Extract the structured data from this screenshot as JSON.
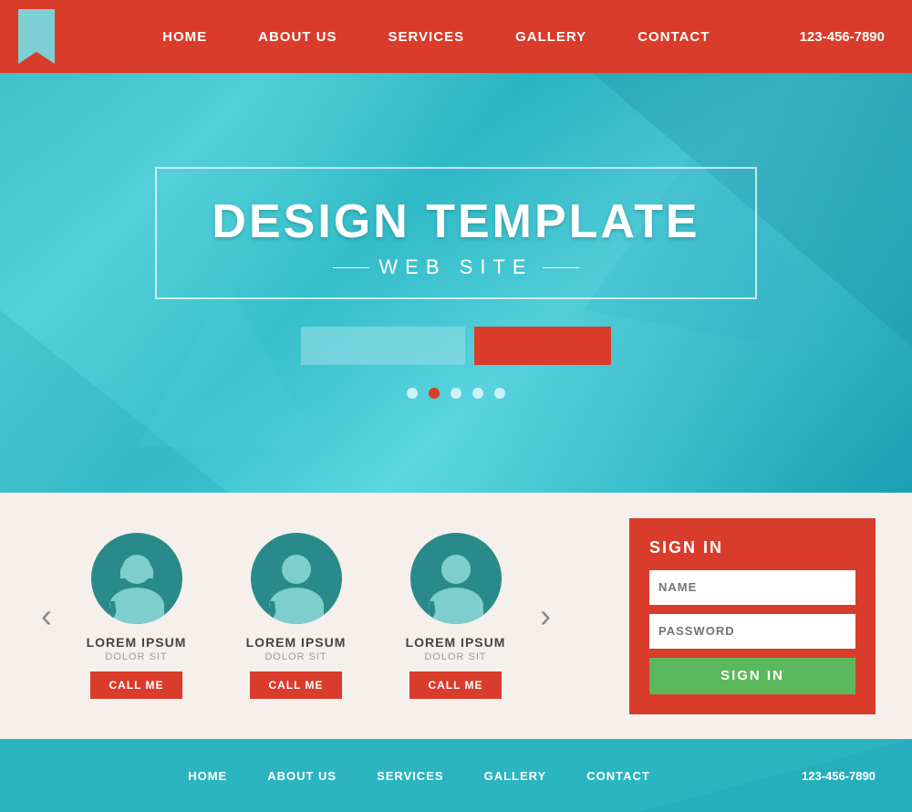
{
  "header": {
    "nav": {
      "home": "HOME",
      "about": "ABOUT US",
      "services": "SERVICES",
      "gallery": "GALLERY",
      "contact": "CONTACT",
      "phone": "123-456-7890"
    }
  },
  "hero": {
    "title": "DESIGN TEMPLATE",
    "subtitle": "WEB SITE",
    "btn1_label": "",
    "btn2_label": "",
    "dots": [
      {
        "active": false
      },
      {
        "active": true
      },
      {
        "active": false
      },
      {
        "active": false
      },
      {
        "active": false
      }
    ]
  },
  "team": {
    "prev_arrow": "‹",
    "next_arrow": "›",
    "cards": [
      {
        "name": "LOREM IPSUM",
        "sub": "DOLOR SIT",
        "call": "CALL ME",
        "gender": "female"
      },
      {
        "name": "LOREM IPSUM",
        "sub": "DOLOR SIT",
        "call": "CALL ME",
        "gender": "male"
      },
      {
        "name": "LOREM IPSUM",
        "sub": "DOLOR SIT",
        "call": "CALL ME",
        "gender": "male"
      }
    ]
  },
  "signin": {
    "title": "SIGN IN",
    "name_placeholder": "NAME",
    "password_placeholder": "PASSWORD",
    "button_label": "SIGN IN"
  },
  "footer": {
    "home": "HOME",
    "about": "ABOUT US",
    "services": "SERVICES",
    "gallery": "GALLERY",
    "contact": "CONTACT",
    "phone": "123-456-7890"
  }
}
